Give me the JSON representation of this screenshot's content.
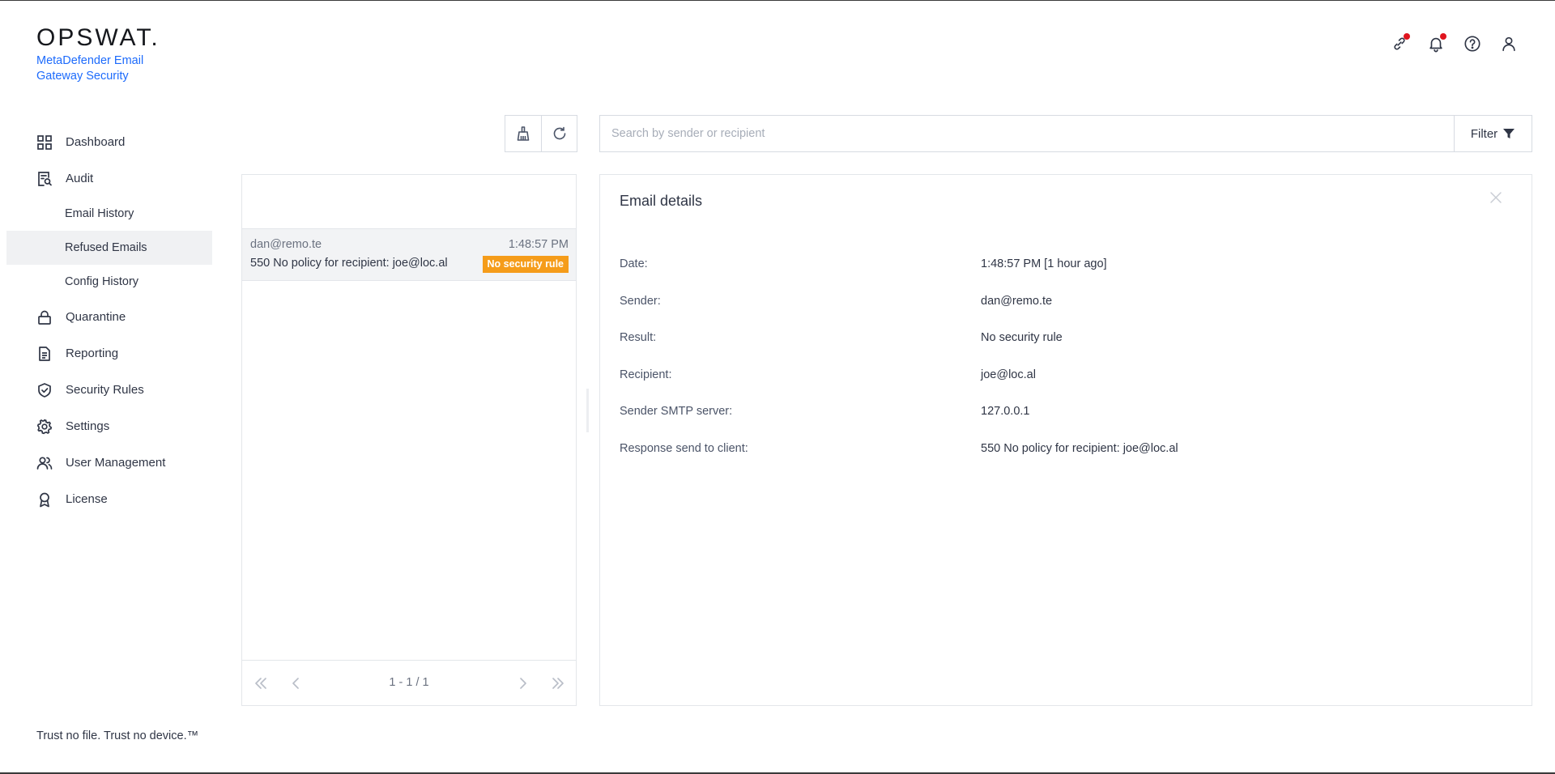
{
  "brand": {
    "logo": "OPSWAT.",
    "product": "MetaDefender Email Gateway Security"
  },
  "top_icons": [
    "link-icon",
    "bell-icon",
    "help-icon",
    "user-icon"
  ],
  "sidebar": {
    "items": [
      {
        "label": "Dashboard",
        "icon": "dashboard-icon"
      },
      {
        "label": "Audit",
        "icon": "audit-icon"
      },
      {
        "label": "Email History",
        "sub": true
      },
      {
        "label": "Refused Emails",
        "sub": true,
        "active": true
      },
      {
        "label": "Config History",
        "sub": true
      },
      {
        "label": "Quarantine",
        "icon": "lock-icon"
      },
      {
        "label": "Reporting",
        "icon": "document-icon"
      },
      {
        "label": "Security Rules",
        "icon": "shield-check-icon"
      },
      {
        "label": "Settings",
        "icon": "gear-icon"
      },
      {
        "label": "User Management",
        "icon": "users-icon"
      },
      {
        "label": "License",
        "icon": "badge-icon"
      }
    ],
    "footer": "Trust no file. Trust no device.™"
  },
  "toolbar": {
    "search_placeholder": "Search by sender or recipient",
    "filter_label": "Filter"
  },
  "list": {
    "items": [
      {
        "sender": "dan@remo.te",
        "time": "1:48:57 PM",
        "response": "550 No policy for recipient: joe@loc.al",
        "badge": "No security rule"
      }
    ],
    "pagination": "1 - 1 / 1"
  },
  "details": {
    "title": "Email details",
    "rows": [
      {
        "label": "Date:",
        "value": "1:48:57 PM [1 hour ago]"
      },
      {
        "label": "Sender:",
        "value": "dan@remo.te"
      },
      {
        "label": "Result:",
        "value": "No security rule"
      },
      {
        "label": "Recipient:",
        "value": "joe@loc.al"
      },
      {
        "label": "Sender SMTP server:",
        "value": "127.0.0.1"
      },
      {
        "label": "Response send to client:",
        "value": "550 No policy for recipient: joe@loc.al"
      }
    ]
  },
  "colors": {
    "accent": "#1d6bfc",
    "badge": "#f59c1a",
    "notification": "#e0141e",
    "active_bg": "#f0f1f3"
  }
}
